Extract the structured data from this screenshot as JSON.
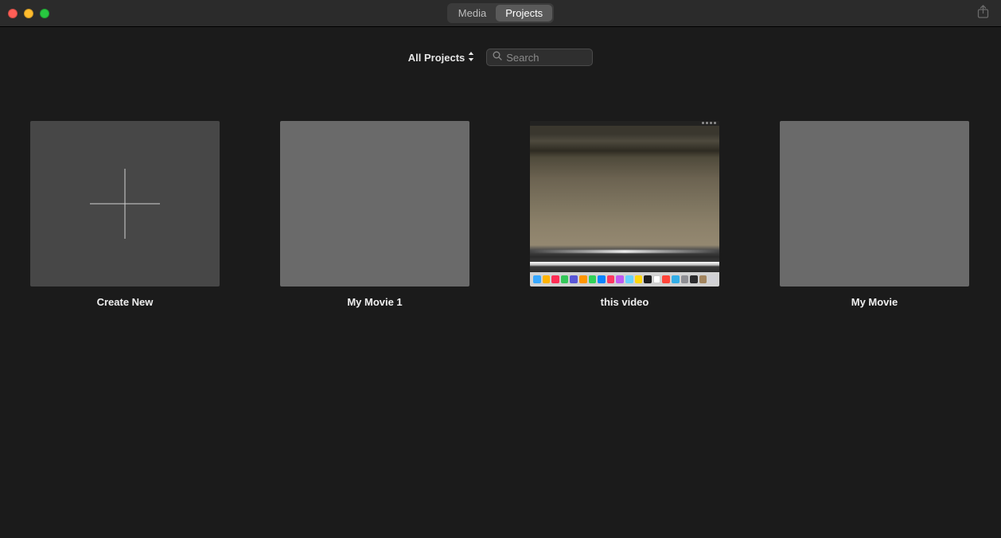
{
  "toolbar": {
    "tabs": {
      "media": "Media",
      "projects": "Projects",
      "active": "projects"
    }
  },
  "filter": {
    "dropdown_label": "All Projects",
    "search_placeholder": "Search",
    "search_value": ""
  },
  "projects": [
    {
      "title": "Create New",
      "kind": "create"
    },
    {
      "title": "My Movie 1",
      "kind": "blank"
    },
    {
      "title": "this video",
      "kind": "screenshot"
    },
    {
      "title": "My Movie",
      "kind": "blank"
    }
  ]
}
